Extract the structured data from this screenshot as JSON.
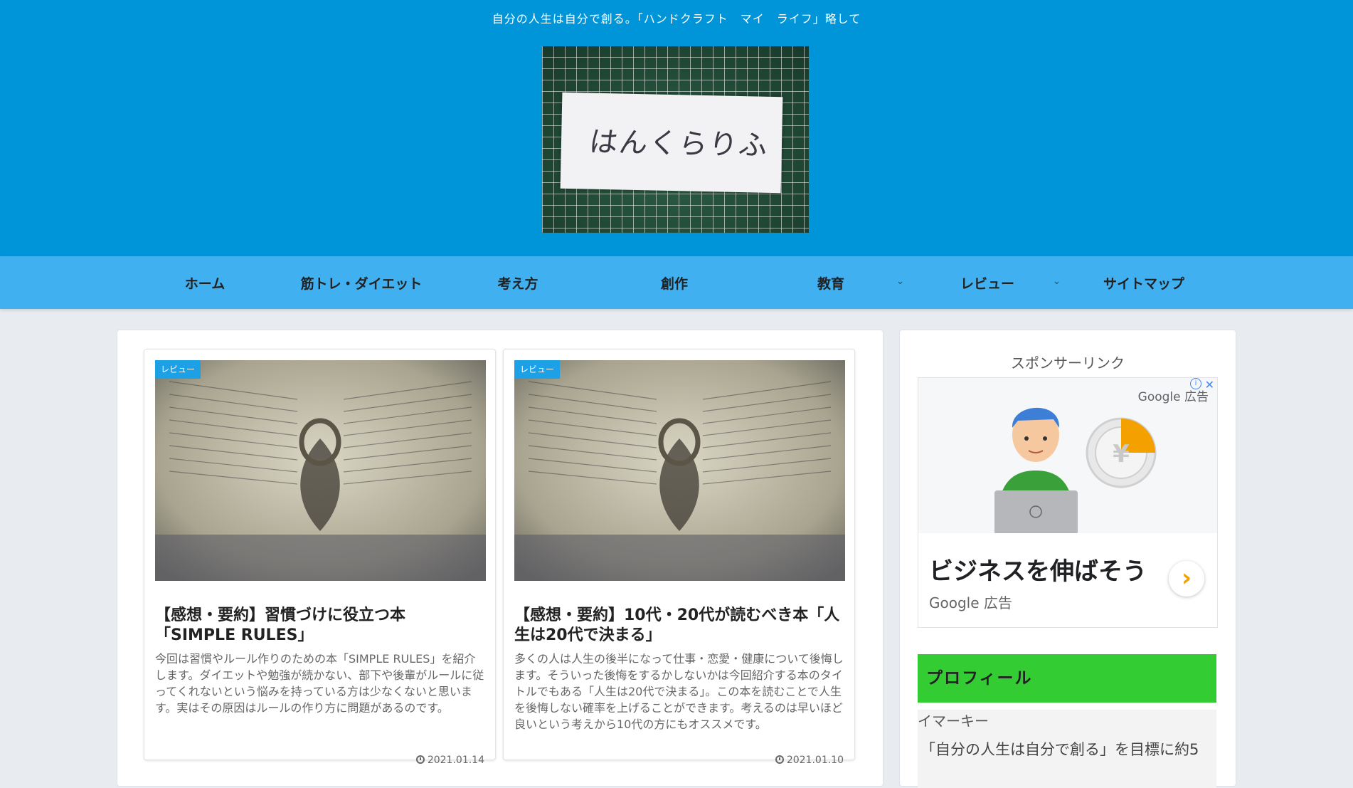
{
  "header": {
    "tagline": "自分の人生は自分で創る。「ハンドクラフト　マイ　ライフ」略して",
    "logo_text": "はんくらりふ"
  },
  "nav": {
    "items": [
      {
        "label": "ホーム",
        "has_dropdown": false
      },
      {
        "label": "筋トレ・ダイエット",
        "has_dropdown": false
      },
      {
        "label": "考え方",
        "has_dropdown": false
      },
      {
        "label": "創作",
        "has_dropdown": false
      },
      {
        "label": "教育",
        "has_dropdown": true
      },
      {
        "label": "レビュー",
        "has_dropdown": true
      },
      {
        "label": "サイトマップ",
        "has_dropdown": false
      }
    ],
    "caret": "⌄"
  },
  "posts": [
    {
      "category": "レビュー",
      "title": "【感想・要約】習慣づけに役立つ本「SIMPLE RULES」",
      "snippet": "今回は習慣やルール作りのための本「SIMPLE RULES」を紹介します。ダイエットや勉強が続かない、部下や後輩がルールに従ってくれないという悩みを持っている方は少なくないと思います。実はその原因はルールの作り方に問題があるのです。",
      "date": "2021.01.14"
    },
    {
      "category": "レビュー",
      "title": "【感想・要約】10代・20代が読むべき本「人生は20代で決まる」",
      "snippet": "多くの人は人生の後半になって仕事・恋愛・健康について後悔します。そういった後悔をするかしないかは今回紹介する本のタイトルでもある「人生は20代で決まる」。この本を読むことで人生を後悔しない確率を上げることができます。考えるのは早いほど良いという考えから10代の方にもオススメです。",
      "date": "2021.01.10"
    }
  ],
  "sidebar": {
    "sponsor_title": "スポンサーリンク",
    "ad": {
      "brand": "Google 広告",
      "headline": "ビジネスを伸ばそう",
      "sub": "Google 広告",
      "arrow": "›",
      "close": "✕",
      "info": "i",
      "coin_symbol": "¥"
    },
    "profile": {
      "title": "プロフィール",
      "name": "イマーキー",
      "desc": "「自分の人生は自分で創る」を目標に約5"
    }
  },
  "colors": {
    "header_bg": "#0095d9",
    "nav_bg": "#40b0f0",
    "category_badge": "#1da1e6",
    "profile_header": "#33cc33",
    "ad_accent": "#f4a100"
  }
}
